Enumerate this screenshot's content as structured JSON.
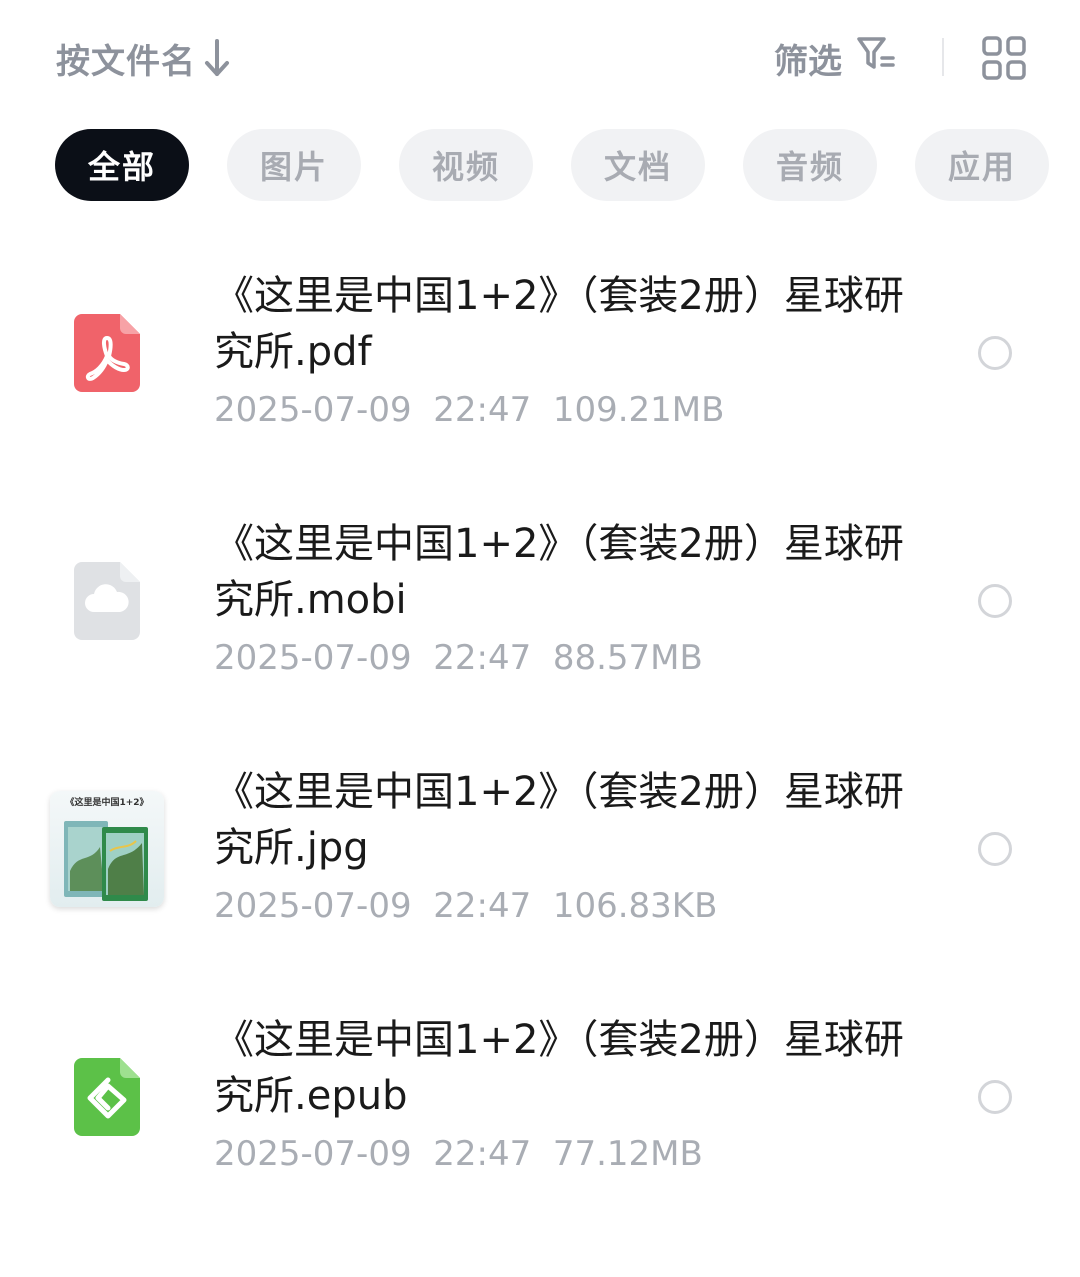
{
  "toolbar": {
    "sort_label": "按文件名",
    "sort_direction_icon": "arrow-down-icon",
    "filter_label": "筛选",
    "filter_icon": "filter-icon",
    "view_icon": "grid-view-icon"
  },
  "tabs": [
    {
      "label": "全部",
      "active": true
    },
    {
      "label": "图片",
      "active": false
    },
    {
      "label": "视频",
      "active": false
    },
    {
      "label": "文档",
      "active": false
    },
    {
      "label": "音频",
      "active": false
    },
    {
      "label": "应用",
      "active": false
    }
  ],
  "files": [
    {
      "name": "《这里是中国1+2》（套装2册）星球研究所.pdf",
      "date": "2025-07-09",
      "time": "22:47",
      "size": "109.21MB",
      "icon": "pdf-icon",
      "icon_color": "#f0636a"
    },
    {
      "name": "《这里是中国1+2》（套装2册）星球研究所.mobi",
      "date": "2025-07-09",
      "time": "22:47",
      "size": "88.57MB",
      "icon": "cloud-file-icon",
      "icon_color": "#dfe1e4"
    },
    {
      "name": "《这里是中国1+2》（套装2册）星球研究所.jpg",
      "date": "2025-07-09",
      "time": "22:47",
      "size": "106.83KB",
      "icon": "image-thumbnail",
      "thumbnail_caption": "《这里是中国1+2》"
    },
    {
      "name": "《这里是中国1+2》（套装2册）星球研究所.epub",
      "date": "2025-07-09",
      "time": "22:47",
      "size": "77.12MB",
      "icon": "epub-icon",
      "icon_color": "#5cc148"
    }
  ]
}
